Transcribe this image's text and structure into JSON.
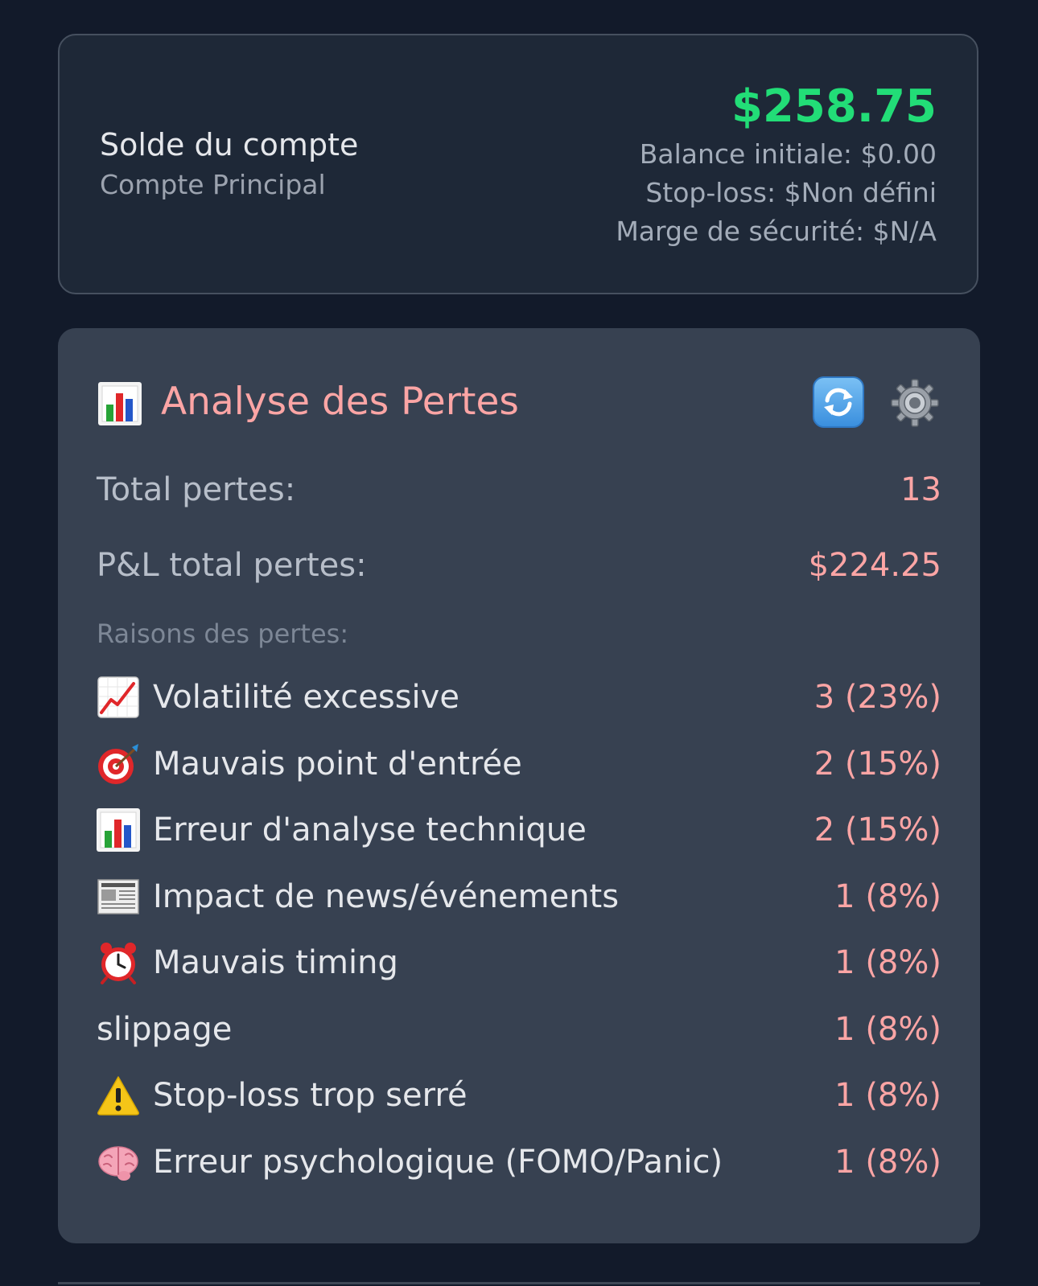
{
  "account": {
    "title": "Solde du compte",
    "subtitle": "Compte Principal",
    "balance": "$258.75",
    "initial_balance": "Balance initiale: $0.00",
    "stop_loss": "Stop-loss: $Non défini",
    "safety_margin": "Marge de sécurité: $N/A",
    "balance_color": "#22dd77"
  },
  "loss_analysis": {
    "icon": "bar-chart-icon",
    "title": "Analyse des Pertes",
    "refresh_icon": "refresh-icon",
    "settings_icon": "gear-icon",
    "stats": [
      {
        "label": "Total pertes:",
        "value": "13"
      },
      {
        "label": "P&L total pertes:",
        "value": "$224.25"
      }
    ],
    "reasons_heading": "Raisons des pertes:",
    "reasons": [
      {
        "icon": "chart-increasing-icon",
        "label": "Volatilité excessive",
        "value": "3 (23%)"
      },
      {
        "icon": "target-icon",
        "label": "Mauvais point d'entrée",
        "value": "2 (15%)"
      },
      {
        "icon": "bar-chart-icon",
        "label": "Erreur d'analyse technique",
        "value": "2 (15%)"
      },
      {
        "icon": "newspaper-icon",
        "label": "Impact de news/événements",
        "value": "1 (8%)"
      },
      {
        "icon": "alarm-clock-icon",
        "label": "Mauvais timing",
        "value": "1 (8%)"
      },
      {
        "icon": "",
        "label": "slippage",
        "value": "1 (8%)"
      },
      {
        "icon": "warning-icon",
        "label": "Stop-loss trop serré",
        "value": "1 (8%)"
      },
      {
        "icon": "brain-icon",
        "label": "Erreur psychologique (FOMO/Panic)",
        "value": "1 (8%)"
      }
    ],
    "title_color": "#fca5a5",
    "value_color": "#fca5a5"
  }
}
